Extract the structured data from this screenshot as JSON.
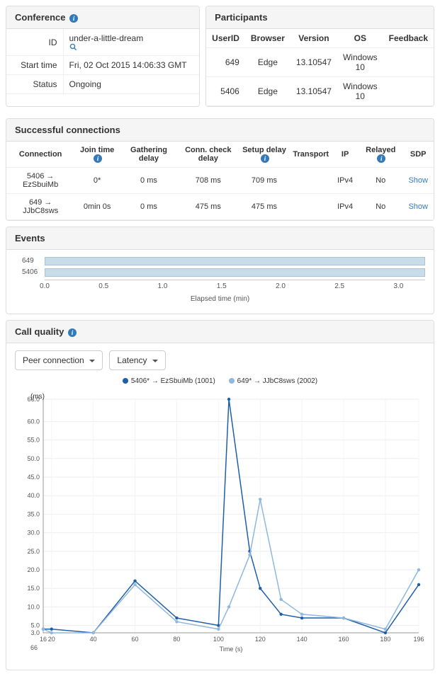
{
  "conference": {
    "title": "Conference",
    "rows": {
      "id_label": "ID",
      "id_value": "under-a-little-dream",
      "start_label": "Start time",
      "start_value": "Fri, 02 Oct 2015 14:06:33 GMT",
      "status_label": "Status",
      "status_value": "Ongoing"
    }
  },
  "participants": {
    "title": "Participants",
    "headers": [
      "UserID",
      "Browser",
      "Version",
      "OS",
      "Feedback"
    ],
    "rows": [
      {
        "userid": "649",
        "browser": "Edge",
        "version": "13.10547",
        "os": "Windows 10",
        "feedback": ""
      },
      {
        "userid": "5406",
        "browser": "Edge",
        "version": "13.10547",
        "os": "Windows 10",
        "feedback": ""
      }
    ]
  },
  "connections": {
    "title": "Successful connections",
    "headers": [
      "Connection",
      "Join time",
      "Gathering delay",
      "Conn. check delay",
      "Setup delay",
      "Transport",
      "IP",
      "Relayed",
      "SDP"
    ],
    "rows": [
      {
        "conn": "5406 → EzSbuiMb",
        "join": "0*",
        "gather": "0 ms",
        "check": "708 ms",
        "setup": "709 ms",
        "transport": "",
        "ip": "IPv4",
        "relayed": "No",
        "sdp": "Show"
      },
      {
        "conn": "649 → JJbC8sws",
        "join": "0min 0s",
        "gather": "0 ms",
        "check": "475 ms",
        "setup": "475 ms",
        "transport": "",
        "ip": "IPv4",
        "relayed": "No",
        "sdp": "Show"
      }
    ]
  },
  "events": {
    "title": "Events",
    "rows": [
      "649",
      "5406"
    ],
    "xlabel": "Elapsed time (min)",
    "ticks": [
      "0.0",
      "0.5",
      "1.0",
      "1.5",
      "2.0",
      "2.5",
      "3.0"
    ]
  },
  "quality": {
    "title": "Call quality",
    "dropdown1": "Peer connection",
    "dropdown2": "Latency"
  },
  "chart_data": {
    "type": "line",
    "ylabel": "(ms)",
    "xlabel": "Time (s)",
    "x": [
      16,
      20,
      40,
      60,
      80,
      100,
      105,
      115,
      120,
      130,
      140,
      160,
      180,
      196
    ],
    "ylim": [
      3,
      66
    ],
    "xlim": [
      16,
      196
    ],
    "yticks": [
      3,
      5,
      10,
      15,
      20,
      25,
      30,
      35,
      40,
      45,
      50,
      55,
      60,
      66
    ],
    "xticks": [
      16,
      20,
      40,
      60,
      80,
      100,
      120,
      140,
      160,
      180,
      196
    ],
    "series": [
      {
        "name": "5406* → EzSbuiMb (1001)",
        "color": "#1f5fa8",
        "values": [
          4,
          4,
          3,
          17,
          7,
          5,
          66,
          25,
          15,
          8,
          7,
          7,
          3,
          16
        ]
      },
      {
        "name": "649* → JJbC8sws (2002)",
        "color": "#8fb7df",
        "values": [
          4,
          3,
          3,
          16,
          6,
          4,
          10,
          24,
          39,
          12,
          8,
          7,
          4,
          20
        ]
      }
    ],
    "bottom_label": "66"
  }
}
